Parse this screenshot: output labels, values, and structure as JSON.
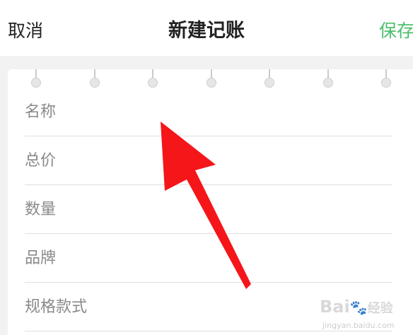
{
  "nav": {
    "cancel_label": "取消",
    "title": "新建记账",
    "save_label": "保存"
  },
  "form": {
    "fields": [
      {
        "label": "名称"
      },
      {
        "label": "总价"
      },
      {
        "label": "数量"
      },
      {
        "label": "品牌"
      },
      {
        "label": "规格款式"
      }
    ]
  },
  "colors": {
    "accent": "#4cbe6c",
    "annotation_arrow": "#f5161a"
  },
  "watermark": {
    "brand": "Bai",
    "brand_suffix": "经验",
    "url": "jingyan.baidu.com"
  }
}
